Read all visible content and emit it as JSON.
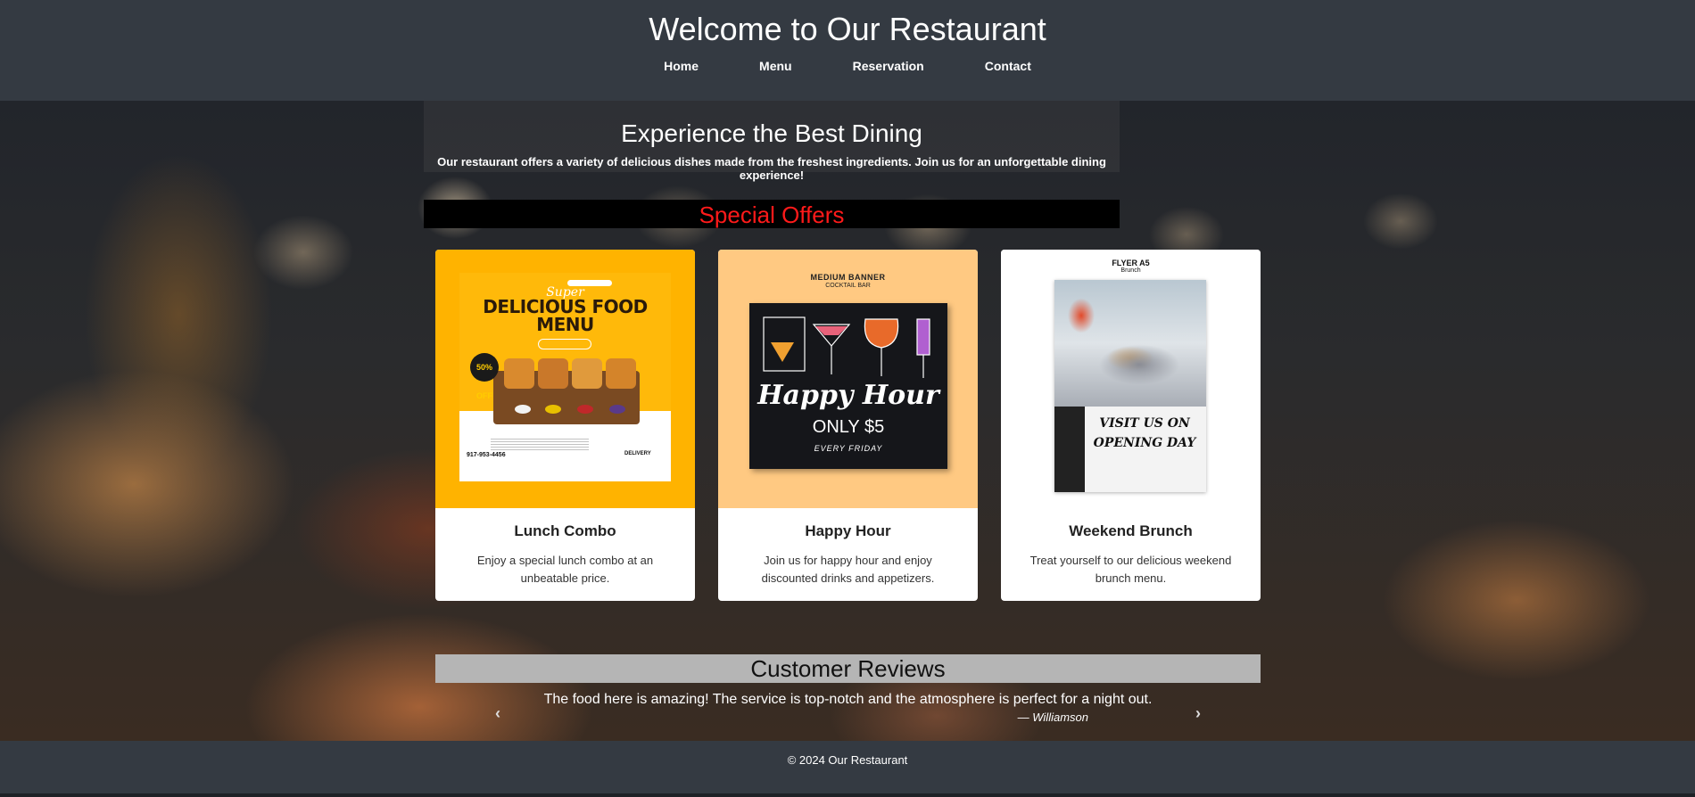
{
  "header": {
    "title": "Welcome to Our Restaurant",
    "nav": [
      "Home",
      "Menu",
      "Reservation",
      "Contact"
    ]
  },
  "hero": {
    "title": "Experience the Best Dining",
    "text": "Our restaurant offers a variety of delicious dishes made from the freshest ingredients. Join us for an unforgettable dining experience!"
  },
  "offers": {
    "title": "Special Offers",
    "title_color": "#ff1a1a",
    "cards": [
      {
        "title": "Lunch Combo",
        "description": "Enjoy a special lunch combo at an unbeatable price.",
        "image": {
          "super": "Super",
          "headline": "DELICIOUS FOOD MENU",
          "badge": "50% OFF",
          "phone": "917-953-4456",
          "delivery": "DELIVERY"
        }
      },
      {
        "title": "Happy Hour",
        "description": "Join us for happy hour and enjoy discounted drinks and appetizers.",
        "image": {
          "header": "MEDIUM BANNER",
          "sub": "COCKTAIL BAR",
          "headline": "Happy Hour",
          "price": "ONLY $5",
          "when": "EVERY FRIDAY"
        }
      },
      {
        "title": "Weekend Brunch",
        "description": "Treat yourself to our delicious weekend brunch menu.",
        "image": {
          "header": "FLYER A5",
          "sub": "Brunch",
          "headline": "VISIT US ON OPENING DAY"
        }
      }
    ]
  },
  "reviews": {
    "title": "Customer Reviews",
    "text": "The food here is amazing! The service is top-notch and the atmosphere is perfect for a night out.",
    "author": "— Williamson",
    "prev_icon": "chevron-left-icon",
    "next_icon": "chevron-right-icon"
  },
  "footer": {
    "text": "© 2024 Our Restaurant"
  }
}
